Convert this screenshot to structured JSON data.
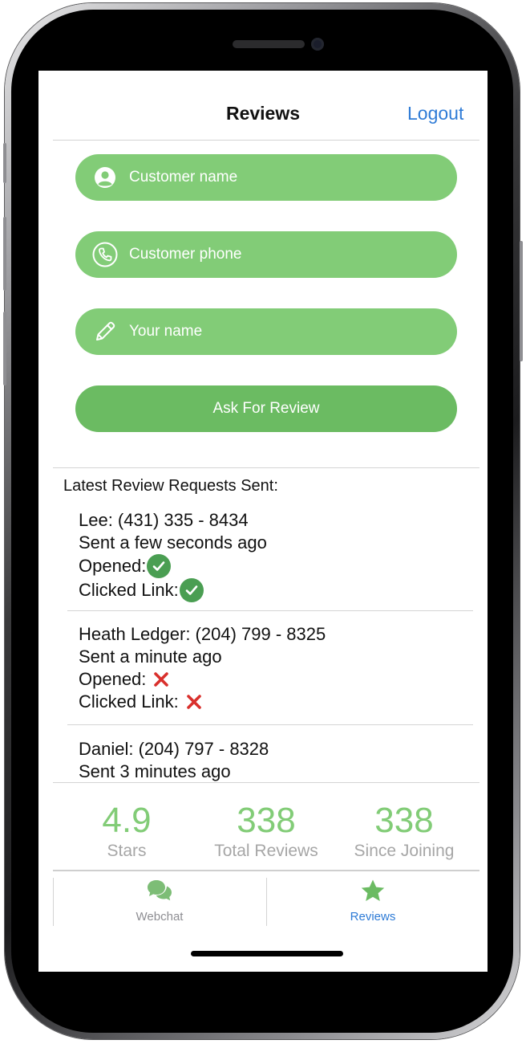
{
  "header": {
    "title": "Reviews",
    "logout_label": "Logout"
  },
  "form": {
    "customer_name": {
      "placeholder": "Customer name",
      "icon": "user-circle-icon"
    },
    "customer_phone": {
      "placeholder": "Customer phone",
      "icon": "phone-icon"
    },
    "your_name": {
      "placeholder": "Your name",
      "icon": "pencil-icon"
    },
    "submit_label": "Ask For Review"
  },
  "requests": {
    "title": "Latest Review Requests Sent:",
    "opened_label": "Opened:",
    "clicked_label": "Clicked Link:",
    "items": [
      {
        "contact": "Lee: (431) 335 - 8434",
        "sent": "Sent a few seconds ago",
        "opened": true,
        "clicked": true
      },
      {
        "contact": "Heath Ledger: (204) 799 - 8325",
        "sent": "Sent a minute ago",
        "opened": false,
        "clicked": false
      },
      {
        "contact": "Daniel: (204) 797 - 8328",
        "sent": "Sent 3 minutes ago"
      }
    ]
  },
  "stats": {
    "stars": {
      "value": "4.9",
      "label": "Stars"
    },
    "total": {
      "value": "338",
      "label": "Total Reviews"
    },
    "since": {
      "value": "338",
      "label": "Since Joining"
    }
  },
  "tabs": [
    {
      "label": "Webchat",
      "icon": "chat-bubbles-icon",
      "active": false
    },
    {
      "label": "Reviews",
      "icon": "star-icon",
      "active": true
    }
  ],
  "colors": {
    "accent_green": "#82cc77",
    "button_green": "#6bbb62",
    "check_green": "#4a9e52",
    "cross_red": "#d9302c",
    "link_blue": "#2e7bd6",
    "muted_gray": "#a6a6a6"
  }
}
